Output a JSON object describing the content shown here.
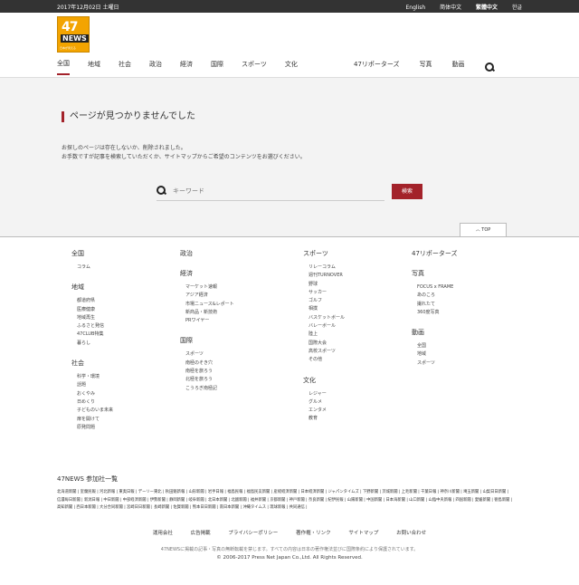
{
  "topbar": {
    "date": "2017年12月02日 土曜日",
    "languages": [
      "English",
      "简体中文",
      "繁體中文",
      "한글"
    ]
  },
  "logo": {
    "number": "47",
    "word": "NEWS",
    "sub": "日本が見える"
  },
  "nav": {
    "left": [
      "全国",
      "地域",
      "社会",
      "政治",
      "経済",
      "国際",
      "スポーツ",
      "文化"
    ],
    "right": [
      "47リポーターズ",
      "写真",
      "動画"
    ]
  },
  "error": {
    "title": "ページが見つかりませんでした",
    "line1": "お探しのページは存在しないか、削除されました。",
    "line2": "お手数ですが記事を検索していただくか、サイトマップからご希望のコンテンツをお選びください。"
  },
  "search": {
    "placeholder": "キーワード",
    "button": "検索"
  },
  "totop": "TOP",
  "footer": {
    "col1": [
      {
        "title": "全国",
        "items": [
          "コラム"
        ]
      },
      {
        "title": "地域",
        "items": [
          "都道府県",
          "医療健康",
          "地域再生",
          "ふるさと発信",
          "47CLUB特集",
          "暮らし"
        ]
      },
      {
        "title": "社会",
        "items": [
          "科学・環境",
          "話題",
          "おくやみ",
          "日めくり",
          "子どものいま未来",
          "扉を開けて",
          "原発問題"
        ]
      }
    ],
    "col2": [
      {
        "title": "政治",
        "items": []
      },
      {
        "title": "経済",
        "items": [
          "マーケット速報",
          "アジア経済",
          "市場ニュース&レポート",
          "新商品・新技術",
          "PRワイヤー"
        ]
      },
      {
        "title": "国際",
        "items": [
          "スポーツ",
          "南極のそき穴",
          "南極を旅ろう",
          "北極を旅ろう",
          "こうろぎ南極記"
        ]
      }
    ],
    "col3": [
      {
        "title": "スポーツ",
        "items": [
          "リレーコラム",
          "週刊TURNOVER",
          "野球",
          "サッカー",
          "ゴルフ",
          "相撲",
          "バスケットボール",
          "バレーボール",
          "陸上",
          "国際大会",
          "高校スポーツ",
          "その他"
        ]
      },
      {
        "title": "文化",
        "items": [
          "レジャー",
          "グルメ",
          "エンタメ",
          "教育"
        ]
      }
    ],
    "col4": [
      {
        "title": "47リポーターズ",
        "items": []
      },
      {
        "title": "写真",
        "items": [
          "FOCUS x FRAME",
          "あのころ",
          "撮れたて",
          "360度写真"
        ]
      },
      {
        "title": "動画",
        "items": [
          "全国",
          "地域",
          "スポーツ"
        ]
      }
    ],
    "papers_title": "47NEWS 参加社一覧",
    "papers": [
      "北海道新聞",
      "室蘭民報",
      "河北新報",
      "東奥日報",
      "デーリー東北",
      "秋田魁新報",
      "山形新聞",
      "岩手日報",
      "福島民報",
      "福島民友新聞",
      "産経経済新聞",
      "日本経済新聞",
      "ジャパンタイムズ",
      "下野新聞",
      "茨城新聞",
      "上毛新聞",
      "千葉日報",
      "神奈川新聞",
      "埼玉新聞",
      "山梨日日新聞",
      "信濃毎日新聞",
      "新潟日報",
      "中日新聞",
      "中部経済新聞",
      "伊勢新聞",
      "静岡新聞",
      "岐阜新聞",
      "北日本新聞",
      "北國新聞",
      "福井新聞",
      "京都新聞",
      "神戸新聞",
      "奈良新聞",
      "紀伊民報",
      "山陽新聞",
      "中国新聞",
      "日本海新聞",
      "山口新聞",
      "山陰中央新報",
      "四国新聞",
      "愛媛新聞",
      "徳島新聞",
      "高知新聞",
      "西日本新聞",
      "大分合同新聞",
      "宮崎日日新聞",
      "長崎新聞",
      "佐賀新聞",
      "熊本日日新聞",
      "南日本新聞",
      "沖縄タイムス",
      "琉球新報",
      "共同通信"
    ],
    "links": [
      "運用会社",
      "広告掲載",
      "プライバシーポリシー",
      "著作権・リンク",
      "サイトマップ",
      "お問い合わせ"
    ],
    "notice": "47NEWSに掲載の記事・写真の無断転載を禁じます。すべての内容は日本の著作権法並びに国際条約により保護されています。",
    "copyright": "© 2006-2017 Press Net Japan Co.,Ltd. All Rights Reserved."
  }
}
